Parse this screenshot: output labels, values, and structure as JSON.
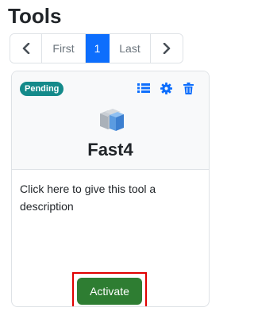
{
  "page": {
    "title": "Tools"
  },
  "pagination": {
    "prev_icon": "chevron-left-icon",
    "first_label": "First",
    "current_page": "1",
    "last_label": "Last",
    "next_icon": "chevron-right-icon"
  },
  "card": {
    "status_badge": "Pending",
    "actions": [
      "list-icon",
      "gear-icon",
      "trash-icon"
    ],
    "logo_icon": "cube-stack-icon",
    "tool_name": "Fast4",
    "description": "Click here to give this tool a description",
    "activate_label": "Activate"
  },
  "colors": {
    "badge": "#148a8a",
    "action_icons": "#0d6efd",
    "page_active": "#0d6efd",
    "activate_button": "#2e7d32",
    "highlight_box": "#e00000"
  }
}
